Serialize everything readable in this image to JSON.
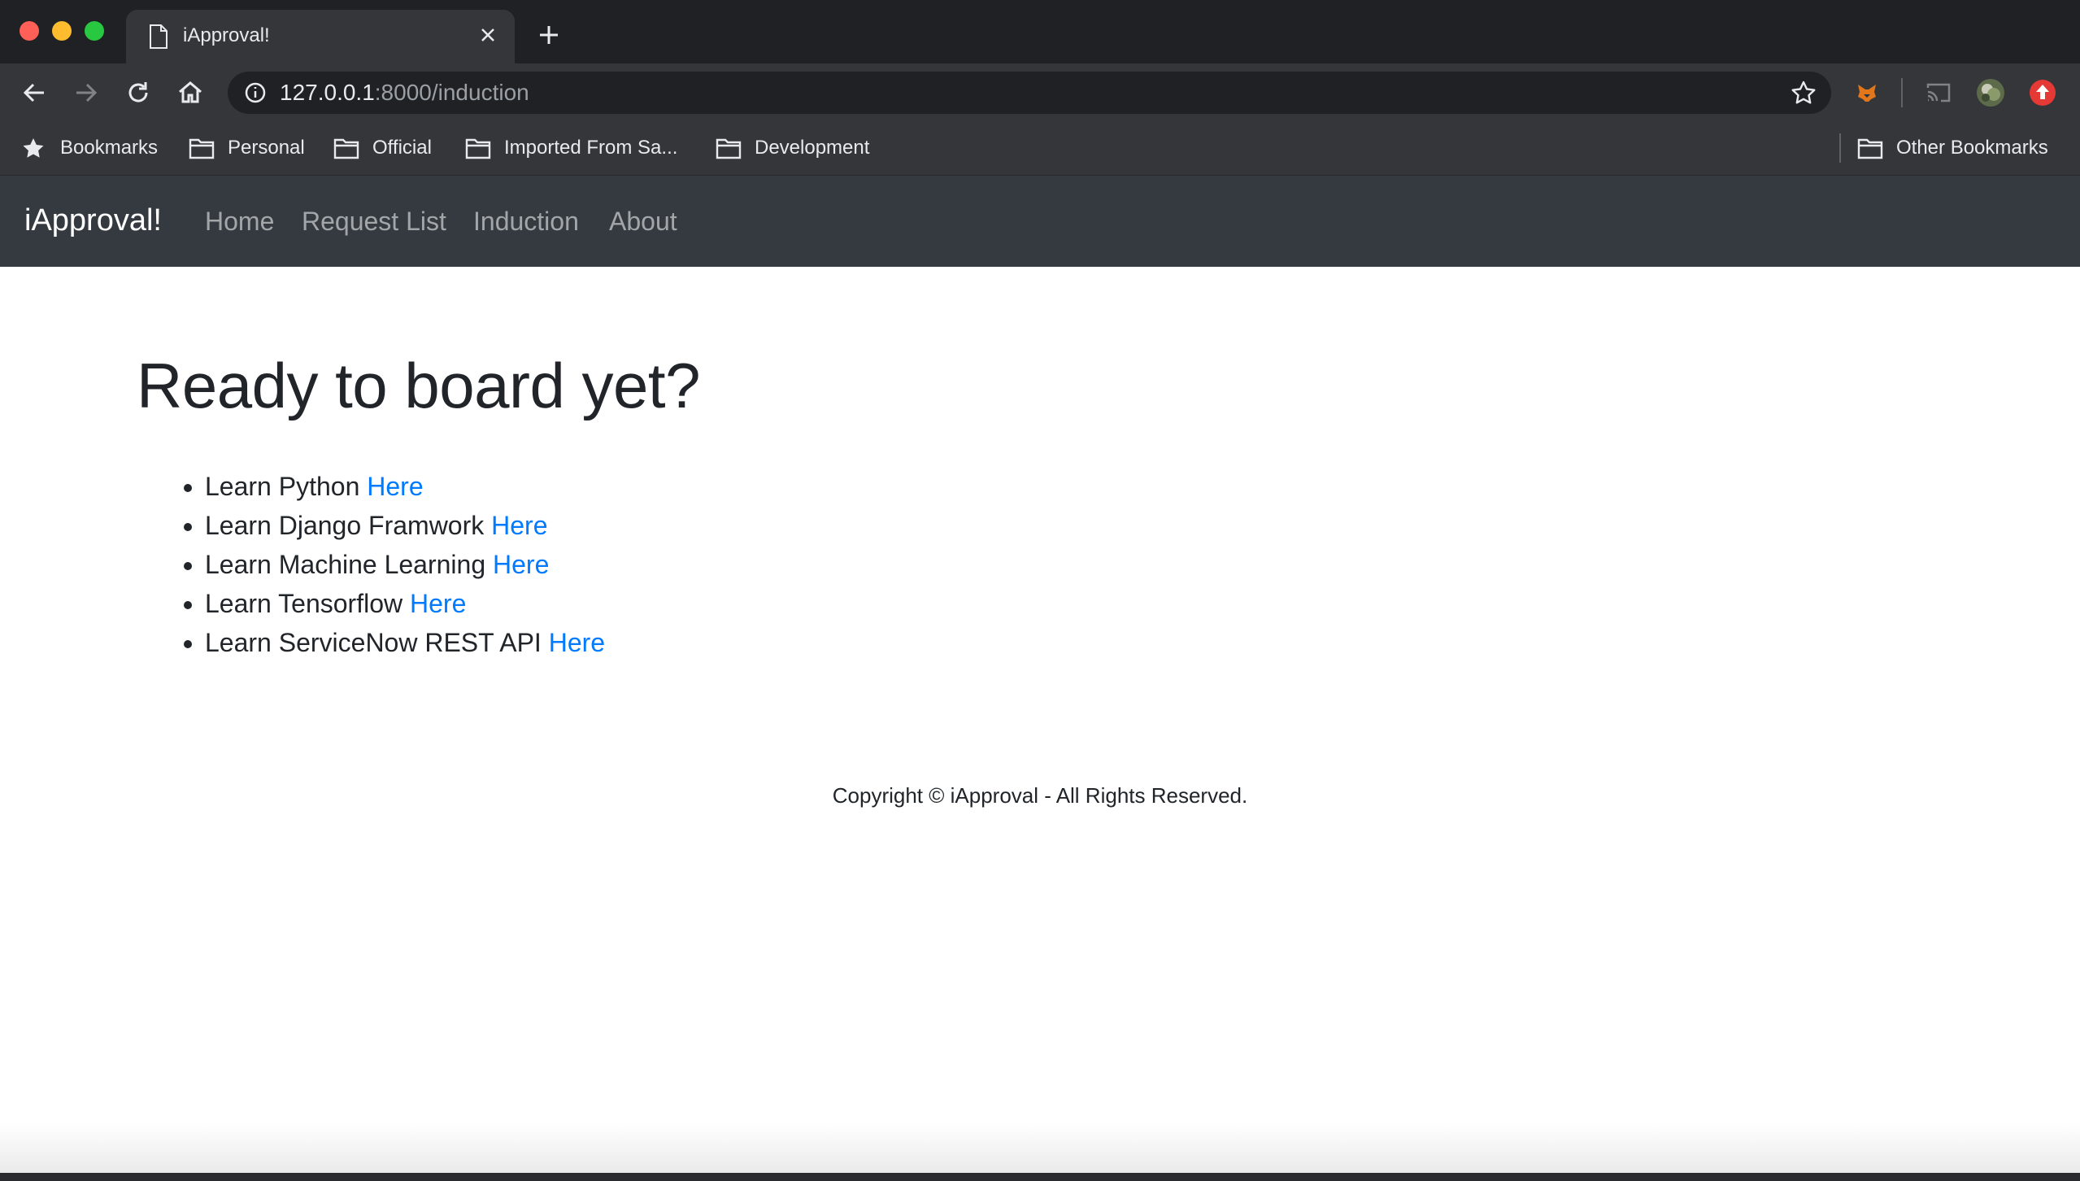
{
  "browser": {
    "tab_title": "iApproval!",
    "url_host": "127.0.0.1",
    "url_rest": ":8000/induction",
    "bookmarks": [
      {
        "label": "Bookmarks",
        "icon": "star-icon"
      },
      {
        "label": "Personal",
        "icon": "folder-icon"
      },
      {
        "label": "Official",
        "icon": "folder-icon"
      },
      {
        "label": "Imported From Sa...",
        "icon": "folder-icon"
      },
      {
        "label": "Development",
        "icon": "folder-icon"
      }
    ],
    "other_bookmarks": "Other Bookmarks"
  },
  "navbar": {
    "brand": "iApproval!",
    "links": [
      "Home",
      "Request List",
      "Induction",
      "About"
    ]
  },
  "main": {
    "heading": "Ready to board yet?",
    "items": [
      {
        "text": "Learn Python",
        "link": "Here"
      },
      {
        "text": "Learn Django Framwork",
        "link": "Here"
      },
      {
        "text": "Learn Machine Learning",
        "link": "Here"
      },
      {
        "text": "Learn Tensorflow",
        "link": "Here"
      },
      {
        "text": "Learn ServiceNow REST API",
        "link": "Here"
      }
    ]
  },
  "footer": {
    "text": "Copyright © iApproval - All Rights Reserved."
  },
  "colors": {
    "navbar_bg": "#343a40",
    "link": "#007bff",
    "chrome_dark": "#202124",
    "chrome_toolbar": "#35363a"
  }
}
